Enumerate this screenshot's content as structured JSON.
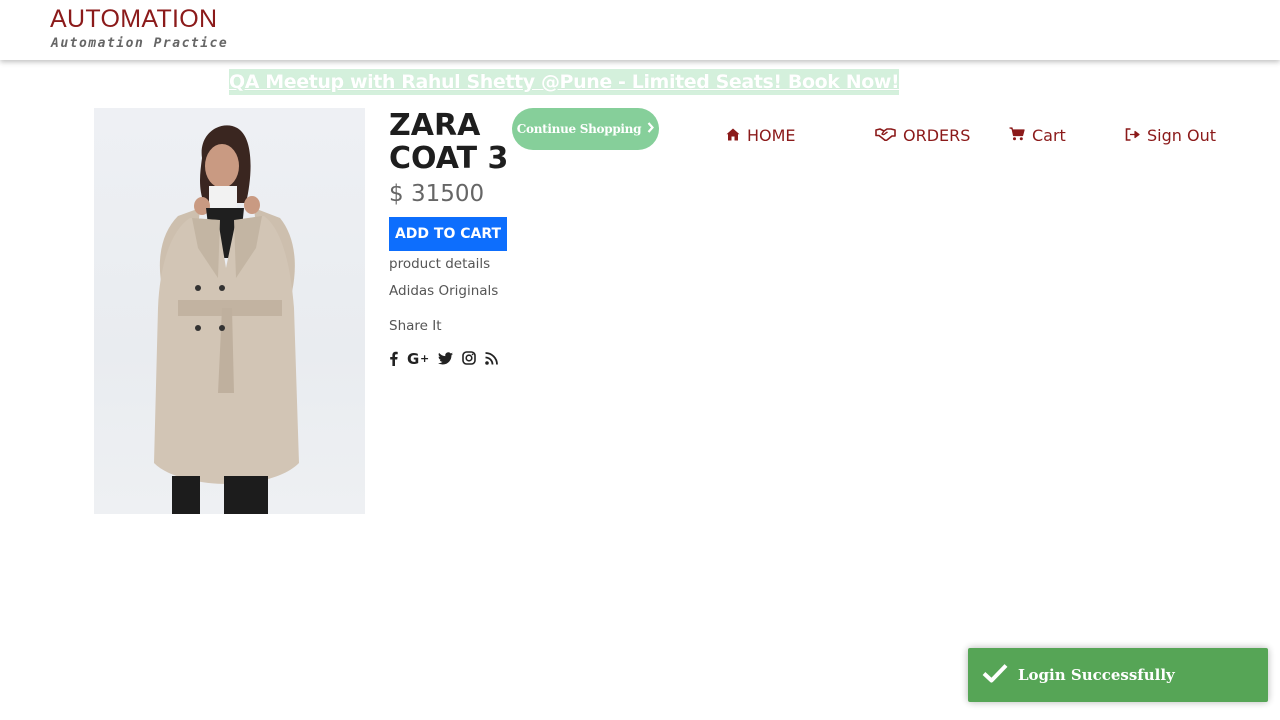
{
  "header": {
    "brand_title": "AUTOMATION",
    "brand_subtitle": "Automation Practice"
  },
  "banner": {
    "text": "QA Meetup with Rahul Shetty @Pune - Limited Seats! Book Now!"
  },
  "product": {
    "name": "ZARA COAT 3",
    "price": "$ 31500",
    "add_to_cart_label": "ADD TO CART",
    "details_label": "product details",
    "brand": "Adidas Originals",
    "share_label": "Share It",
    "share_icons": [
      "facebook-icon",
      "google-plus-icon",
      "twitter-icon",
      "instagram-icon",
      "rss-icon"
    ]
  },
  "continue_button": {
    "label": "Continue Shopping",
    "icon": "chevron-right-icon"
  },
  "nav": {
    "home": "HOME",
    "orders": "ORDERS",
    "cart": "Cart",
    "sign_out": "Sign Out"
  },
  "toast": {
    "message": "Login Successfully",
    "icon": "checkmark-icon"
  },
  "colors": {
    "brand": "#8b1a1a",
    "primary_button": "#0d6efd",
    "continue_button": "#86cf9a",
    "banner_bg": "#d4f0dc",
    "toast_bg": "#51a351"
  }
}
